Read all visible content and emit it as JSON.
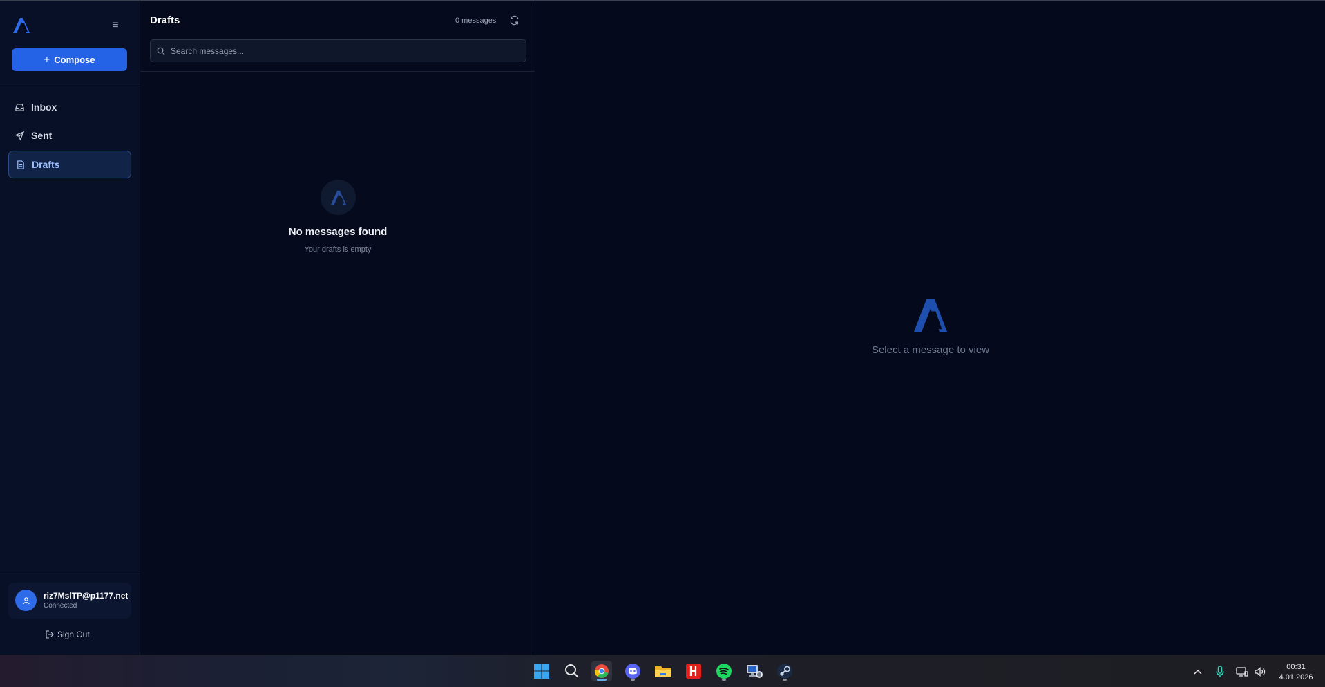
{
  "sidebar": {
    "compose_label": "Compose",
    "nav": [
      {
        "label": "Inbox",
        "icon": "inbox-icon"
      },
      {
        "label": "Sent",
        "icon": "send-icon"
      },
      {
        "label": "Drafts",
        "icon": "file-icon",
        "active": true
      }
    ],
    "account": {
      "email": "riz7MslTP@p1177.net",
      "status": "Connected"
    },
    "signout_label": "Sign Out"
  },
  "list": {
    "title": "Drafts",
    "count": "0 messages",
    "search_placeholder": "Search messages...",
    "empty_title": "No messages found",
    "empty_subtitle": "Your drafts is empty"
  },
  "reading_pane": {
    "placeholder": "Select a message to view"
  },
  "taskbar": {
    "apps": [
      "windows-start-icon",
      "search-icon",
      "chrome-icon",
      "discord-icon",
      "file-explorer-icon",
      "red-app-icon",
      "spotify-icon",
      "network-app-icon",
      "steam-icon"
    ],
    "time": "00:31",
    "date": "4.01.2026"
  },
  "colors": {
    "accent": "#2462e6",
    "background": "#050b1d",
    "active_nav": "#112448"
  }
}
